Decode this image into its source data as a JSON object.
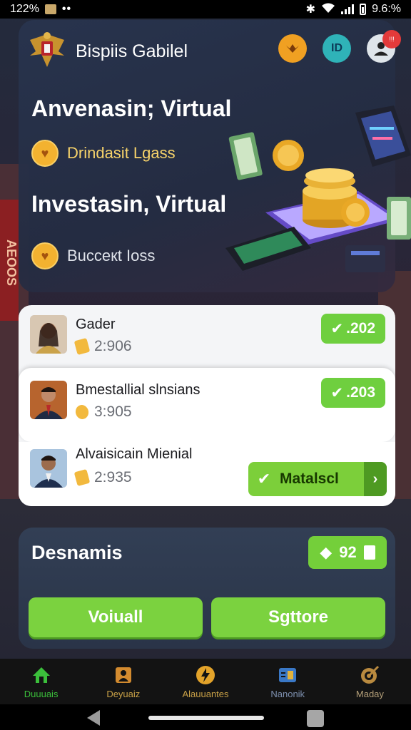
{
  "status_bar": {
    "left_text": "122%",
    "dots": "••",
    "right_text": "9.6:%"
  },
  "background_sign_text": "AEOOS",
  "header": {
    "title": "Bispiis Gabilel",
    "icons": [
      "coin-icon",
      "id-icon",
      "profile-icon"
    ],
    "id_icon_text": "ID",
    "notification_badge": "!!!"
  },
  "hero": {
    "heading_1": "Anvenasin; Virtual",
    "subtitle_1": "Drindasit Lgass",
    "heading_2": "Investasin, Virtual",
    "subtitle_2": "Bucceкt Ioss"
  },
  "list": {
    "rows": [
      {
        "name": "Gader",
        "value": "2:906",
        "badge": ".202",
        "badge_icon": "check-icon"
      },
      {
        "name": "Bmestallial slnsians",
        "value": "3:905",
        "badge": ".203",
        "badge_icon": "check-icon"
      },
      {
        "name": "Alvaisicain Mienial",
        "value": "2:935",
        "action_label": "Matalscl",
        "action_icon": "chevron-right-icon"
      }
    ]
  },
  "bottom_card": {
    "title": "Desnamis",
    "badge_value": "92",
    "button_1": "Voiuall",
    "button_2": "Sgttore"
  },
  "nav": {
    "items": [
      {
        "label": "Duuuais",
        "icon": "home-icon"
      },
      {
        "label": "Deyuaiz",
        "icon": "square-figure-icon"
      },
      {
        "label": "Alauuantes",
        "icon": "bolt-icon"
      },
      {
        "label": "Nanonik",
        "icon": "card-icon"
      },
      {
        "label": "Maday",
        "icon": "target-icon"
      }
    ]
  },
  "colors": {
    "accent_green": "#74cf3a",
    "coin_orange": "#f0a022",
    "subtitle_gold": "#f7d36a",
    "nav_active": "#3bbf3b"
  }
}
